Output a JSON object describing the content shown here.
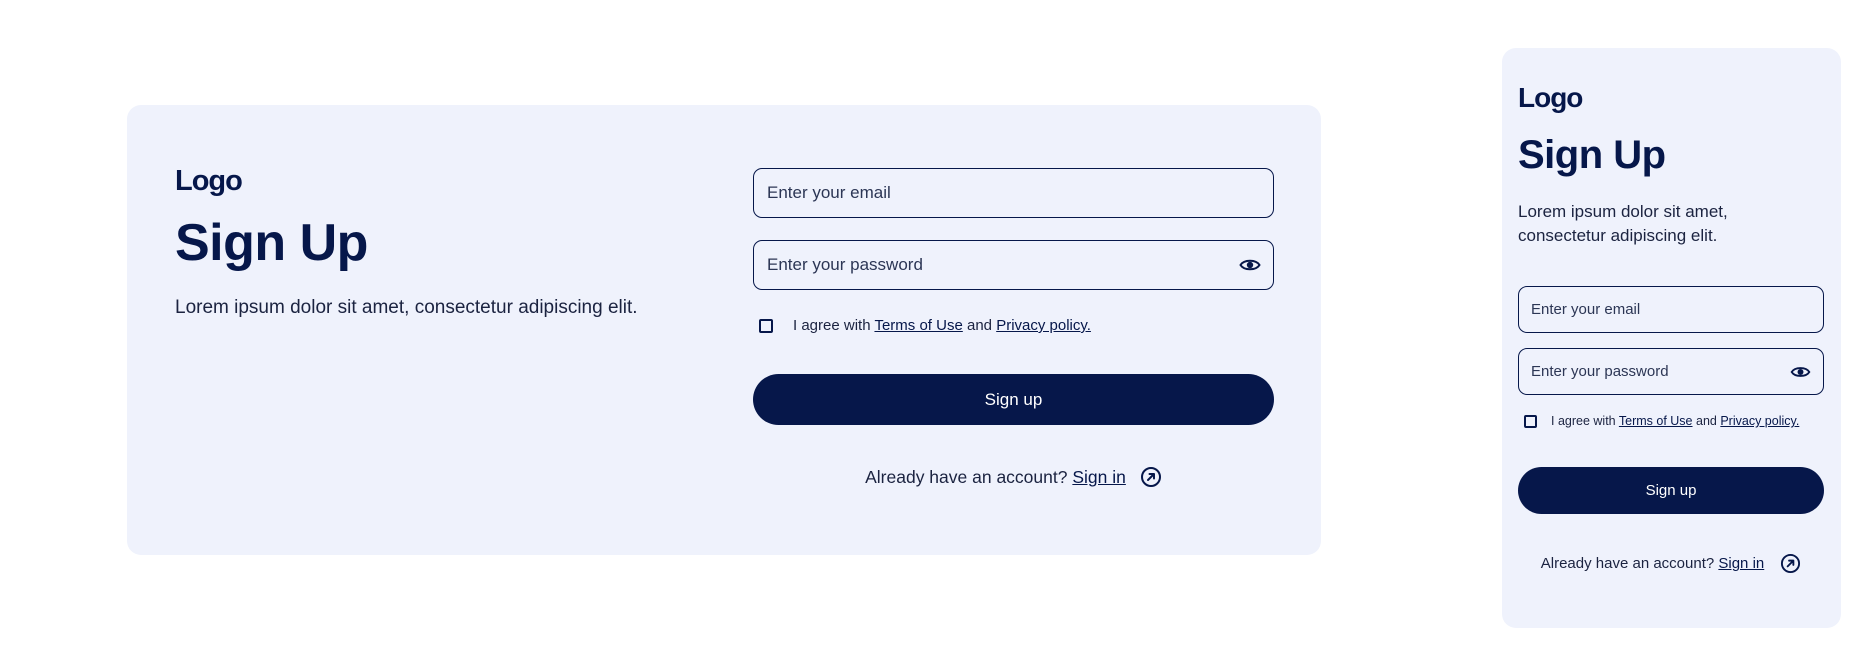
{
  "colors": {
    "brand": "#06174a",
    "card_bg": "#eff2fc",
    "page_bg": "#ffffff"
  },
  "desktop": {
    "logo": "Logo",
    "title": "Sign Up",
    "subtitle": "Lorem ipsum dolor sit amet, consectetur adipiscing elit.",
    "email_placeholder": "Enter your email",
    "password_placeholder": "Enter your password",
    "agree_prefix": "I agree with",
    "terms_link": "Terms of Use",
    "agree_and": "and",
    "privacy_link": "Privacy policy.",
    "submit_label": "Sign up",
    "signin_prompt": "Already have an account?",
    "signin_link": "Sign in"
  },
  "mobile": {
    "logo": "Logo",
    "title": "Sign Up",
    "subtitle": "Lorem ipsum dolor sit amet, consectetur adipiscing elit.",
    "email_placeholder": "Enter your email",
    "password_placeholder": "Enter your password",
    "agree_prefix": "I agree with",
    "terms_link": "Terms of Use",
    "agree_and": "and",
    "privacy_link": "Privacy policy.",
    "submit_label": "Sign up",
    "signin_prompt": "Already have an account?",
    "signin_link": "Sign in"
  },
  "icons": {
    "password_toggle": "eye-icon",
    "signin_arrow": "arrow-up-right-circle-icon"
  }
}
